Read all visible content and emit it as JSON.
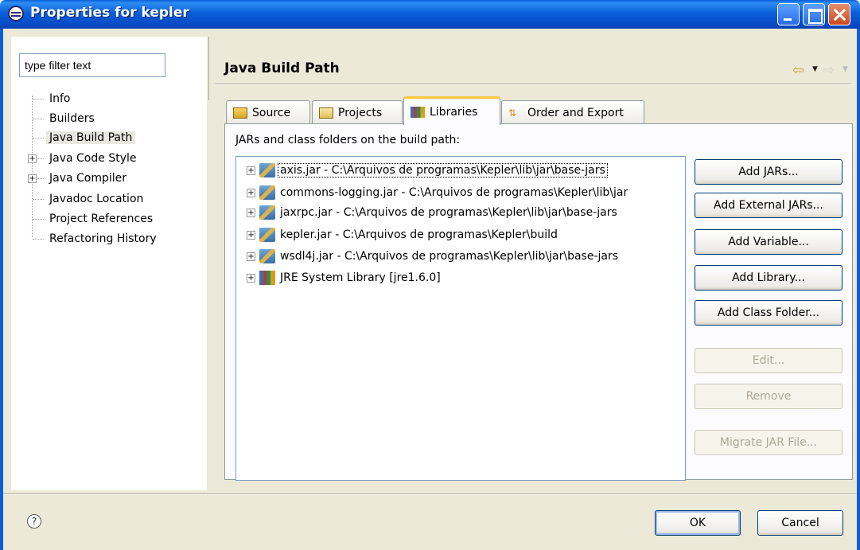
{
  "window": {
    "title": "Properties for kepler"
  },
  "filter": {
    "value": "type filter text"
  },
  "tree": {
    "items": [
      {
        "label": "Info"
      },
      {
        "label": "Builders"
      },
      {
        "label": "Java Build Path",
        "selected": true
      },
      {
        "label": "Java Code Style",
        "expandable": true
      },
      {
        "label": "Java Compiler",
        "expandable": true
      },
      {
        "label": "Javadoc Location"
      },
      {
        "label": "Project References"
      },
      {
        "label": "Refactoring History"
      }
    ]
  },
  "page": {
    "title": "Java Build Path"
  },
  "tabs": [
    {
      "label": "Source"
    },
    {
      "label": "Projects"
    },
    {
      "label": "Libraries",
      "active": true
    },
    {
      "label": "Order and Export"
    }
  ],
  "libraries": {
    "heading": "JARs and class folders on the build path:",
    "entries": [
      {
        "text": "axis.jar - C:\\Arquivos de programas\\Kepler\\lib\\jar\\base-jars"
      },
      {
        "text": "commons-logging.jar - C:\\Arquivos de programas\\Kepler\\lib\\jar"
      },
      {
        "text": "jaxrpc.jar - C:\\Arquivos de programas\\Kepler\\lib\\jar\\base-jars"
      },
      {
        "text": "kepler.jar - C:\\Arquivos de programas\\Kepler\\build"
      },
      {
        "text": "wsdl4j.jar - C:\\Arquivos de programas\\Kepler\\lib\\jar\\base-jars"
      },
      {
        "text": "JRE System Library [jre1.6.0]"
      }
    ]
  },
  "buttons": {
    "add_jars": "Add JARs...",
    "add_external_jars": "Add External JARs...",
    "add_variable": "Add Variable...",
    "add_library": "Add Library...",
    "add_class_folder": "Add Class Folder...",
    "edit": "Edit...",
    "remove": "Remove",
    "migrate": "Migrate JAR File..."
  },
  "footer": {
    "ok": "OK",
    "cancel": "Cancel",
    "help_icon": "?"
  }
}
